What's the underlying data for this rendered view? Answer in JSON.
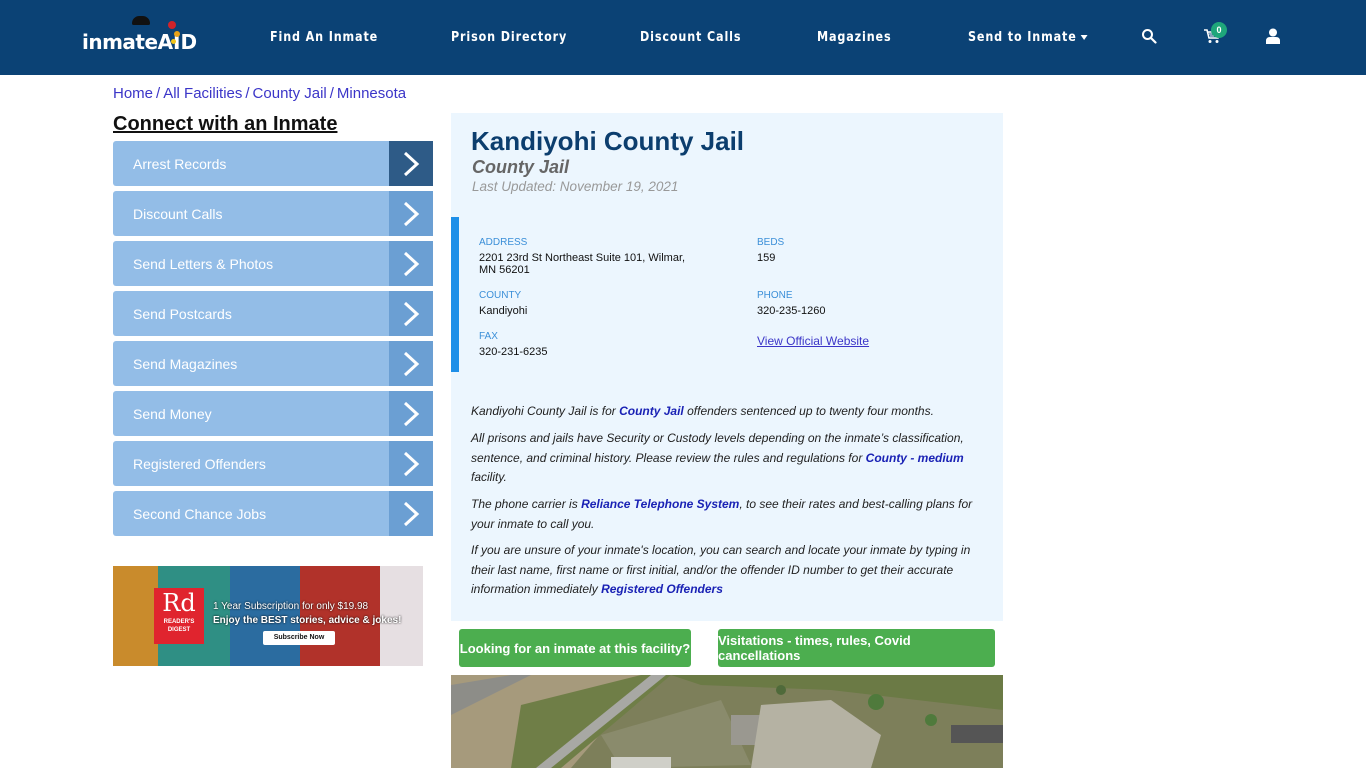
{
  "header": {
    "logo": {
      "text": "inmate",
      "accent": "AID"
    },
    "nav": [
      {
        "label": "Find An Inmate"
      },
      {
        "label": "Prison Directory"
      },
      {
        "label": "Discount Calls"
      },
      {
        "label": "Magazines"
      },
      {
        "label": "Send to Inmate"
      }
    ],
    "icons": {
      "search": "search-icon",
      "cart": "cart-icon",
      "user": "user-icon"
    },
    "cart_count": "0",
    "colors": {
      "bar": "#0b4275",
      "badge": "#1fa67a"
    }
  },
  "breadcrumb": [
    {
      "label": "Home"
    },
    {
      "label": "All Facilities"
    },
    {
      "label": "County Jail"
    },
    {
      "label": "Minnesota"
    }
  ],
  "breadcrumb_separator": "/",
  "sidebar": {
    "title": "Connect with an Inmate",
    "items": [
      {
        "label": "Arrest Records"
      },
      {
        "label": "Discount Calls"
      },
      {
        "label": "Send Letters & Photos"
      },
      {
        "label": "Send Postcards"
      },
      {
        "label": "Send Magazines"
      },
      {
        "label": "Send Money"
      },
      {
        "label": "Registered Offenders"
      },
      {
        "label": "Second Chance Jobs"
      }
    ],
    "ad": {
      "brand_big": "Rd",
      "brand_small_1": "READER'S",
      "brand_small_2": "DIGEST",
      "line1": "1 Year Subscription for only $19.98",
      "line2": "Enjoy the BEST stories, advice & jokes!",
      "button": "Subscribe Now"
    }
  },
  "facility": {
    "name": "Kandiyohi County Jail",
    "type": "County Jail",
    "last_updated": "Last Updated: November 19, 2021",
    "details": {
      "address_label": "ADDRESS",
      "address_line1": "2201 23rd St Northeast Suite 101, Wilmar,",
      "address_line2": "MN 56201",
      "beds_label": "BEDS",
      "beds": "159",
      "county_label": "COUNTY",
      "county": "Kandiyohi",
      "phone_label": "PHONE",
      "phone": "320-235-1260",
      "fax_label": "FAX",
      "fax": "320-231-6235",
      "website_link": "View Official Website"
    },
    "paragraphs": {
      "p1_a": "Kandiyohi County Jail is for ",
      "p1_link": "County Jail",
      "p1_b": " offenders sentenced up to twenty four months.",
      "p2_a": "All prisons and jails have Security or Custody levels depending on the inmate’s classification, sentence, and criminal history. Please review the rules and regulations for ",
      "p2_link": "County - medium",
      "p2_b": " facility.",
      "p3_a": "The phone carrier is ",
      "p3_link": "Reliance Telephone System",
      "p3_b": ", to see their rates and best-calling plans for your inmate to call you.",
      "p4_a": "If you are unsure of your inmate's location, you can search and locate your inmate by typing in their last name, first name or first initial, and/or the offender ID number to get their accurate information immediately ",
      "p4_link": "Registered Offenders"
    },
    "buttons": {
      "look": "Looking for an inmate at this facility?",
      "visit": "Visitations - times, rules, Covid cancellations"
    }
  }
}
